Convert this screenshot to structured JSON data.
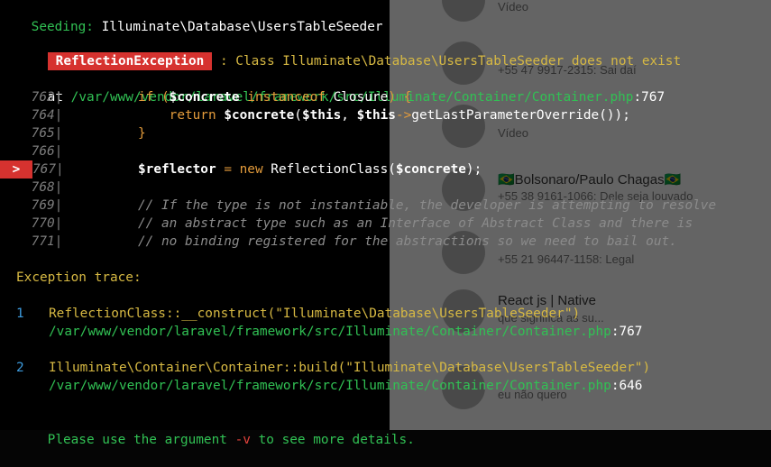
{
  "seeding": {
    "label": "Seeding:",
    "class": "Illuminate\\Database\\UsersTableSeeder"
  },
  "exception": {
    "type": "ReflectionException",
    "separator": ":",
    "message": "Class Illuminate\\Database\\UsersTableSeeder does not exist"
  },
  "location": {
    "at": "at",
    "path": "/var/www/vendor/laravel/framework/src/Illuminate/Container/Container.php",
    "line": ":767"
  },
  "code": {
    "highlight_marker": ">",
    "lines": [
      {
        "num": "763|",
        "seg": [
          [
            "kw",
            "if ("
          ],
          [
            "var",
            "$concrete "
          ],
          [
            "kw",
            "instanceof "
          ],
          [
            "cls",
            "Closure"
          ],
          [
            "kw",
            ") {"
          ]
        ]
      },
      {
        "num": "764|",
        "seg": [
          [
            "kw",
            "    return "
          ],
          [
            "var",
            "$concrete"
          ],
          [
            "cls",
            "("
          ],
          [
            "var",
            "$this"
          ],
          [
            "cls",
            ", "
          ],
          [
            "var",
            "$this"
          ],
          [
            "kw",
            "->"
          ],
          [
            "cls",
            "getLastParameterOverride());"
          ]
        ]
      },
      {
        "num": "765|",
        "seg": [
          [
            "kw",
            "}"
          ]
        ]
      },
      {
        "num": "766|",
        "seg": []
      },
      {
        "num": "767|",
        "seg": [
          [
            "var",
            "$reflector "
          ],
          [
            "kw",
            "= new "
          ],
          [
            "cls",
            "ReflectionClass("
          ],
          [
            "var",
            "$concrete"
          ],
          [
            "cls",
            ");"
          ]
        ]
      },
      {
        "num": "768|",
        "seg": []
      },
      {
        "num": "769|",
        "seg": [
          [
            "cmt",
            "// If the type is not instantiable, the developer is attempting to resolve"
          ]
        ]
      },
      {
        "num": "770|",
        "seg": [
          [
            "cmt",
            "// an abstract type such as an Interface of Abstract Class and there is"
          ]
        ]
      },
      {
        "num": "771|",
        "seg": [
          [
            "cmt",
            "// no binding registered for the abstractions so we need to bail out."
          ]
        ]
      }
    ]
  },
  "trace": {
    "title": "Exception trace:",
    "items": [
      {
        "index": "1",
        "call": "ReflectionClass::__construct(\"Illuminate\\Database\\UsersTableSeeder\")",
        "path": "/var/www/vendor/laravel/framework/src/Illuminate/Container/Container.php",
        "line": ":767"
      },
      {
        "index": "2",
        "call": "Illuminate\\Container\\Container::build(\"Illuminate\\Database\\UsersTableSeeder\")",
        "path": "/var/www/vendor/laravel/framework/src/Illuminate/Container/Container.php",
        "line": ":646"
      }
    ]
  },
  "hint": {
    "before": "Please use the argument ",
    "arg": "-v",
    "after": " to see more details."
  },
  "background_chats": [
    {
      "name": "",
      "sub": "Vídeo"
    },
    {
      "name": "",
      "sub": "+55 47 9917-2315: Sai daí"
    },
    {
      "name": "",
      "sub": "Vídeo"
    },
    {
      "name": "🇧🇷Bolsonaro/Paulo Chagas🇧🇷",
      "sub": "+55 38 9161-1066: Dele seja louvado"
    },
    {
      "name": "",
      "sub": "+55 21 96447-1158: Legal"
    },
    {
      "name": "React js | Native",
      "sub": "que significa as su..."
    },
    {
      "name": "",
      "sub": "eu não quero"
    }
  ],
  "colors": {
    "terminal_bg": "#050505",
    "green": "#31c154",
    "yellow": "#d7b943",
    "red_badge": "#d6322f",
    "orange": "#e39b3b"
  }
}
